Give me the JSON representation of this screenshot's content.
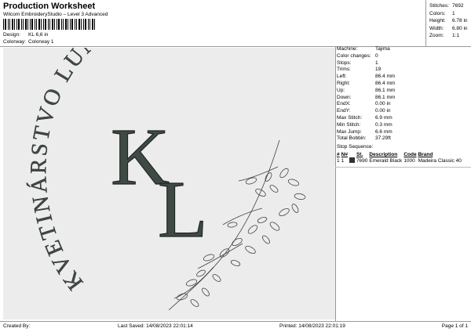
{
  "header": {
    "title": "Production Worksheet",
    "subtitle": "Wilcom EmbroideryStudio – Level 3 Advanced"
  },
  "design_info": [
    {
      "label": "Design:",
      "value": "KL 6,6 in"
    },
    {
      "label": "Colorway:",
      "value": "Colorway 1"
    }
  ],
  "summary": [
    {
      "label": "Stitches:",
      "value": "7692"
    },
    {
      "label": "Colors:",
      "value": "1"
    },
    {
      "label": "Height:",
      "value": "6.78 in"
    },
    {
      "label": "Width:",
      "value": "6.80 in"
    },
    {
      "label": "Zoom:",
      "value": "1:1"
    }
  ],
  "design": {
    "arc_text": "KVETINÁRSTVO LUNA",
    "monogram_k": "K",
    "monogram_l": "L",
    "thread_color": "#3f4a44"
  },
  "machine_details": [
    {
      "label": "Machine:",
      "value": "Tajima"
    },
    {
      "label": "Color changes:",
      "value": "0"
    },
    {
      "label": "Stops:",
      "value": "1"
    },
    {
      "label": "Trims:",
      "value": "19"
    },
    {
      "label": "Left:",
      "value": "86.4 mm"
    },
    {
      "label": "Right:",
      "value": "86.4 mm"
    },
    {
      "label": "Up:",
      "value": "86.1 mm"
    },
    {
      "label": "Down:",
      "value": "86.1 mm"
    },
    {
      "label": "EndX:",
      "value": "0.00 in"
    },
    {
      "label": "EndY:",
      "value": "0.00 in"
    },
    {
      "label": "Max Stitch:",
      "value": "6.9 mm"
    },
    {
      "label": "Min Stitch:",
      "value": "0.3 mm"
    },
    {
      "label": "Max Jump:",
      "value": "6.6 mm"
    },
    {
      "label": "Total Bobbin:",
      "value": "37.29ft"
    }
  ],
  "stop_sequence": {
    "title": "Stop Sequence:",
    "headers": [
      "#",
      "N#",
      "St.",
      "Description",
      "Code",
      "Brand"
    ],
    "rows": [
      {
        "num": "1",
        "n": "1",
        "color": "#333333",
        "st": "7690",
        "description": "Emerald Black",
        "code": "1000",
        "brand": "Madeira Classic 40"
      }
    ]
  },
  "footer": {
    "created_by": "Created By:",
    "last_saved": "Last Saved: 14/08/2023 22:01:14",
    "printed": "Printed: 14/08/2023 22:01:19",
    "page": "Page 1 of 1"
  }
}
